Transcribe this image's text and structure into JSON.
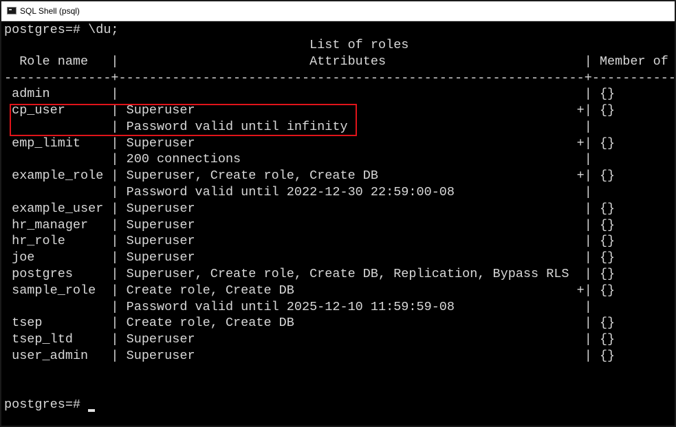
{
  "window": {
    "title": "SQL Shell (psql)",
    "icon": "console-icon"
  },
  "terminal": {
    "command_line": "postgres=# \\du;",
    "table_title": "                                        List of roles",
    "header": "  Role name   |                         Attributes                          | Member of",
    "separator": "--------------+-------------------------------------------------------------+-----------",
    "rows": [
      " admin        |                                                             | {}",
      " cp_user      | Superuser                                                  +| {}",
      "              | Password valid until infinity                               |",
      " emp_limit    | Superuser                                                  +| {}",
      "              | 200 connections                                             |",
      " example_role | Superuser, Create role, Create DB                          +| {}",
      "              | Password valid until 2022-12-30 22:59:00-08                 |",
      " example_user | Superuser                                                   | {}",
      " hr_manager   | Superuser                                                   | {}",
      " hr_role      | Superuser                                                   | {}",
      " joe          | Superuser                                                   | {}",
      " postgres     | Superuser, Create role, Create DB, Replication, Bypass RLS  | {}",
      " sample_role  | Create role, Create DB                                     +| {}",
      "              | Password valid until 2025-12-10 11:59:59-08                 |",
      " tsep         | Create role, Create DB                                      | {}",
      " tsep_ltd     | Superuser                                                   | {}",
      " user_admin   | Superuser                                                   | {}"
    ],
    "prompt": "postgres=# "
  },
  "colors": {
    "terminal_bg": "#000000",
    "terminal_text": "#d8d8d8",
    "highlight": "#e0141a"
  }
}
